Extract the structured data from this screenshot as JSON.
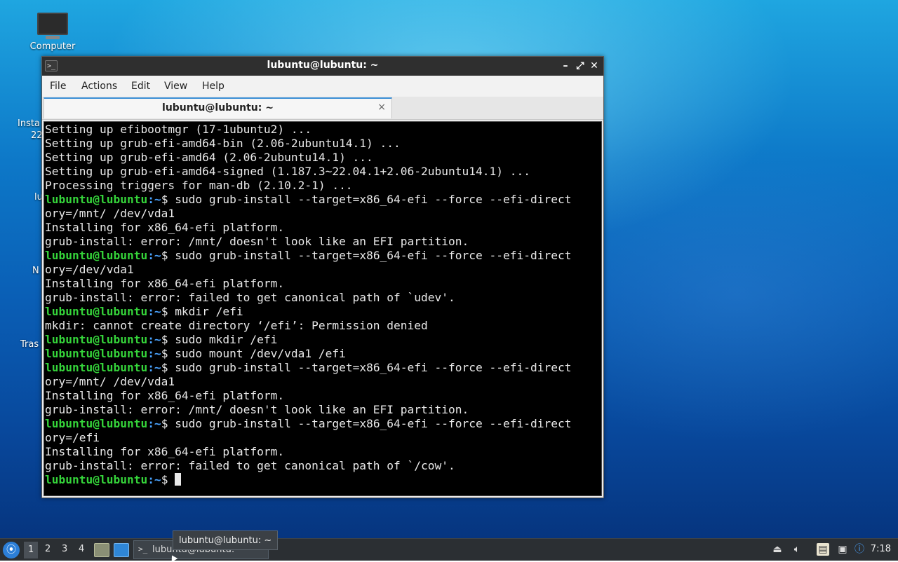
{
  "desktop": {
    "icons": [
      {
        "label": "Computer",
        "icon": "computer-icon"
      }
    ],
    "partial_labels": [
      "Insta",
      "22",
      "lu",
      "N",
      "Tras"
    ]
  },
  "window": {
    "title": "lubuntu@lubuntu: ~",
    "icon": "terminal-icon",
    "controls": {
      "minimize": "–",
      "maximize": "⤢",
      "close": "✕"
    },
    "menu": [
      "File",
      "Actions",
      "Edit",
      "View",
      "Help"
    ],
    "tab": {
      "title": "lubuntu@lubuntu: ~",
      "close": "×"
    }
  },
  "terminal": {
    "prompt_user": "lubuntu@lubuntu",
    "prompt_path": ":~",
    "prompt_sign": "$ ",
    "lines": [
      {
        "type": "out",
        "text": "Setting up efibootmgr (17-1ubuntu2) ..."
      },
      {
        "type": "out",
        "text": "Setting up grub-efi-amd64-bin (2.06-2ubuntu14.1) ..."
      },
      {
        "type": "out",
        "text": "Setting up grub-efi-amd64 (2.06-2ubuntu14.1) ..."
      },
      {
        "type": "out",
        "text": "Setting up grub-efi-amd64-signed (1.187.3~22.04.1+2.06-2ubuntu14.1) ..."
      },
      {
        "type": "out",
        "text": "Processing triggers for man-db (2.10.2-1) ..."
      },
      {
        "type": "cmd",
        "text": "sudo grub-install --target=x86_64-efi --force --efi-direct"
      },
      {
        "type": "out",
        "text": "ory=/mnt/ /dev/vda1"
      },
      {
        "type": "out",
        "text": "Installing for x86_64-efi platform."
      },
      {
        "type": "out",
        "text": "grub-install: error: /mnt/ doesn't look like an EFI partition."
      },
      {
        "type": "cmd",
        "text": "sudo grub-install --target=x86_64-efi --force --efi-direct"
      },
      {
        "type": "out",
        "text": "ory=/dev/vda1"
      },
      {
        "type": "out",
        "text": "Installing for x86_64-efi platform."
      },
      {
        "type": "out",
        "text": "grub-install: error: failed to get canonical path of `udev'."
      },
      {
        "type": "cmd",
        "text": "mkdir /efi"
      },
      {
        "type": "out",
        "text": "mkdir: cannot create directory ‘/efi’: Permission denied"
      },
      {
        "type": "cmd",
        "text": "sudo mkdir /efi"
      },
      {
        "type": "cmd",
        "text": "sudo mount /dev/vda1 /efi"
      },
      {
        "type": "cmd",
        "text": "sudo grub-install --target=x86_64-efi --force --efi-direct"
      },
      {
        "type": "out",
        "text": "ory=/mnt/ /dev/vda1"
      },
      {
        "type": "out",
        "text": "Installing for x86_64-efi platform."
      },
      {
        "type": "out",
        "text": "grub-install: error: /mnt/ doesn't look like an EFI partition."
      },
      {
        "type": "cmd",
        "text": "sudo grub-install --target=x86_64-efi --force --efi-direct"
      },
      {
        "type": "out",
        "text": "ory=/efi"
      },
      {
        "type": "out",
        "text": "Installing for x86_64-efi platform."
      },
      {
        "type": "out",
        "text": "grub-install: error: failed to get canonical path of `/cow'."
      },
      {
        "type": "prompt",
        "text": ""
      }
    ]
  },
  "taskbar": {
    "desktops": [
      "1",
      "2",
      "3",
      "4"
    ],
    "active_desktop": "1",
    "task_label": "lubuntu@lubuntu: ~",
    "tooltip": "lubuntu@lubuntu: ~",
    "clock": "7:18",
    "colors": {
      "bar": "#2b2f33",
      "accent": "#2c7fd8"
    }
  }
}
